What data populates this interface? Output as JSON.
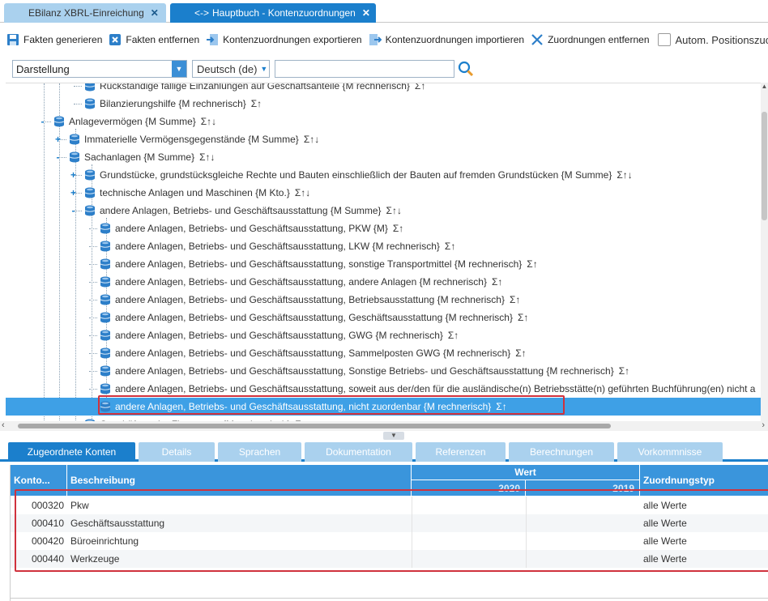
{
  "doc_tabs": [
    {
      "label": "EBilanz XBRL-Einreichung",
      "active": false
    },
    {
      "label": "Hauptbuch - Kontenzuordnungen",
      "active": true
    }
  ],
  "toolbar": {
    "generate": "Fakten generieren",
    "remove_facts": "Fakten entfernen",
    "export": "Kontenzuordnungen exportieren",
    "import": "Kontenzuordnungen importieren",
    "remove_assign": "Zuordnungen entfernen",
    "auto_position": "Autom. Positionszuordnu"
  },
  "filter": {
    "view": "Darstellung",
    "language": "Deutsch (de)",
    "search_value": ""
  },
  "tree": [
    {
      "label": "Rückständige fällige Einzahlungen auf Geschäftsanteile {M rechnerisch}",
      "sig": "Σ↑"
    },
    {
      "label": "Bilanzierungshilfe {M rechnerisch}",
      "sig": "Σ↑"
    },
    {
      "label": "Anlagevermögen {M Summe}",
      "sig": "Σ↑↓"
    },
    {
      "label": "Immaterielle Vermögensgegenstände {M Summe}",
      "sig": "Σ↑↓"
    },
    {
      "label": "Sachanlagen {M Summe}",
      "sig": "Σ↑↓"
    },
    {
      "label": "Grundstücke, grundstücksgleiche Rechte und Bauten einschließlich der Bauten auf fremden Grundstücken {M Summe}",
      "sig": "Σ↑↓"
    },
    {
      "label": "technische Anlagen und Maschinen {M Kto.}",
      "sig": "Σ↑↓"
    },
    {
      "label": "andere Anlagen, Betriebs- und Geschäftsausstattung {M Summe}",
      "sig": "Σ↑↓"
    },
    {
      "label": "andere Anlagen, Betriebs- und Geschäftsausstattung, PKW {M}",
      "sig": "Σ↑"
    },
    {
      "label": "andere Anlagen, Betriebs- und Geschäftsausstattung, LKW {M rechnerisch}",
      "sig": "Σ↑"
    },
    {
      "label": "andere Anlagen, Betriebs- und Geschäftsausstattung, sonstige Transportmittel {M rechnerisch}",
      "sig": "Σ↑"
    },
    {
      "label": "andere Anlagen, Betriebs- und Geschäftsausstattung, andere Anlagen {M rechnerisch}",
      "sig": "Σ↑"
    },
    {
      "label": "andere Anlagen, Betriebs- und Geschäftsausstattung, Betriebsausstattung {M rechnerisch}",
      "sig": "Σ↑"
    },
    {
      "label": "andere Anlagen, Betriebs- und Geschäftsausstattung, Geschäftsausstattung {M rechnerisch}",
      "sig": "Σ↑"
    },
    {
      "label": "andere Anlagen, Betriebs- und Geschäftsausstattung, GWG {M rechnerisch}",
      "sig": "Σ↑"
    },
    {
      "label": "andere Anlagen, Betriebs- und Geschäftsausstattung, Sammelposten GWG {M rechnerisch}",
      "sig": "Σ↑"
    },
    {
      "label": "andere Anlagen, Betriebs- und Geschäftsausstattung, Sonstige Betriebs- und Geschäftsausstattung {M rechnerisch}",
      "sig": "Σ↑"
    },
    {
      "label": "andere Anlagen, Betriebs- und Geschäftsausstattung, soweit aus der/den für die ausländische(n) Betriebsstätte(n) geführten Buchführung(en) nicht a",
      "sig": ""
    },
    {
      "label": "andere Anlagen, Betriebs- und Geschäftsausstattung, nicht zuordenbar {M rechnerisch}",
      "sig": "Σ↑"
    },
    {
      "label": "Geschäfts- oder Firmenwert {M rechnerisch}",
      "sig": "Σ↑"
    }
  ],
  "bottom_tabs": [
    "Zugeordnete Konten",
    "Details",
    "Sprachen",
    "Dokumentation",
    "Referenzen",
    "Berechnungen",
    "Vorkommnisse"
  ],
  "grid": {
    "headers": {
      "konto": "Konto...",
      "beschreibung": "Beschreibung",
      "wert": "Wert",
      "y1": "2020",
      "y2": "2019",
      "zuordnungstyp": "Zuordnungstyp"
    },
    "rows": [
      {
        "konto": "000320",
        "beschreibung": "Pkw",
        "typ": "alle Werte"
      },
      {
        "konto": "000410",
        "beschreibung": "Geschäftsausstattung",
        "typ": "alle Werte"
      },
      {
        "konto": "000420",
        "beschreibung": "Büroeinrichtung",
        "typ": "alle Werte"
      },
      {
        "konto": "000440",
        "beschreibung": "Werkzeuge",
        "typ": "alle Werte"
      }
    ]
  },
  "colors": {
    "accent": "#1b7fcc",
    "selection": "#3ea0e6",
    "highlight": "#d0323d",
    "tab_inactive": "#aad1ee"
  }
}
